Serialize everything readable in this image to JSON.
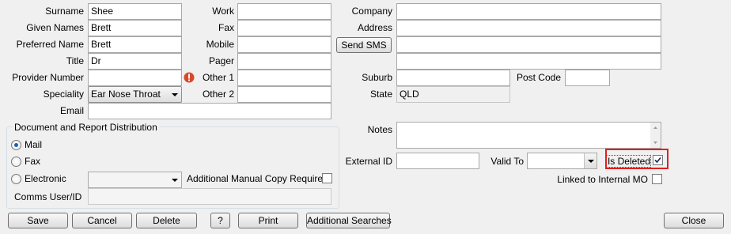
{
  "personal": {
    "surname_label": "Surname",
    "surname_value": "Shee",
    "given_names_label": "Given Names",
    "given_names_value": "Brett",
    "preferred_name_label": "Preferred Name",
    "preferred_name_value": "Brett",
    "title_label": "Title",
    "title_value": "Dr",
    "provider_number_label": "Provider Number",
    "provider_number_value": "",
    "speciality_label": "Speciality",
    "speciality_value": "Ear Nose Throat",
    "email_label": "Email",
    "email_value": ""
  },
  "contact": {
    "work_label": "Work",
    "work_value": "",
    "fax_label": "Fax",
    "fax_value": "",
    "mobile_label": "Mobile",
    "mobile_value": "",
    "pager_label": "Pager",
    "pager_value": "",
    "other1_label": "Other 1",
    "other1_value": "",
    "other2_label": "Other 2",
    "other2_value": "",
    "send_sms_label": "Send SMS"
  },
  "address": {
    "company_label": "Company",
    "company_value": "",
    "address_label": "Address",
    "address_line1": "",
    "address_line2": "",
    "address_line3": "",
    "suburb_label": "Suburb",
    "suburb_value": "",
    "postcode_label": "Post Code",
    "postcode_value": "",
    "state_label": "State",
    "state_value": "QLD",
    "notes_label": "Notes",
    "notes_value": "",
    "external_id_label": "External ID",
    "external_id_value": "",
    "valid_to_label": "Valid To",
    "valid_to_value": "",
    "is_deleted_label": "Is Deleted",
    "is_deleted_checked": true,
    "linked_label": "Linked to Internal MO",
    "linked_checked": false
  },
  "distribution": {
    "group_title": "Document and Report Distribution",
    "mail_label": "Mail",
    "fax_label": "Fax",
    "electronic_label": "Electronic",
    "selected": "Mail",
    "electronic_value": "",
    "manual_copy_label": "Additional Manual Copy Required",
    "manual_copy_checked": false,
    "comms_label": "Comms User/ID",
    "comms_value": ""
  },
  "buttons": {
    "save": "Save",
    "cancel": "Cancel",
    "delete": "Delete",
    "help": "?",
    "print": "Print",
    "additional_searches": "Additional Searches",
    "close": "Close"
  },
  "colors": {
    "highlight_border": "#e02020",
    "warning_icon": "#d9482b"
  }
}
